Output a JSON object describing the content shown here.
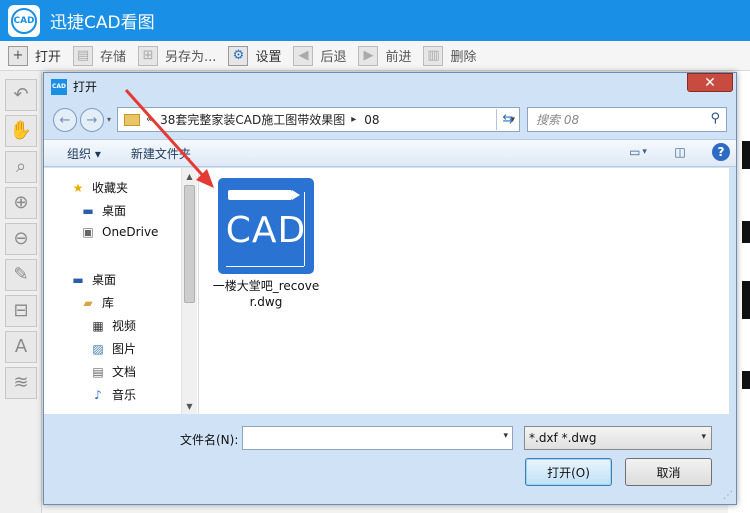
{
  "app": {
    "logo_text": "CAD",
    "title": "迅捷CAD看图"
  },
  "toolbar": [
    {
      "id": "open",
      "label": "打开",
      "icon": "plus-icon"
    },
    {
      "id": "save",
      "label": "存储",
      "icon": "disk-icon"
    },
    {
      "id": "save_as",
      "label": "另存为...",
      "icon": "save-as-icon"
    },
    {
      "id": "settings",
      "label": "设置",
      "icon": "gear-icon"
    },
    {
      "id": "back",
      "label": "后退",
      "icon": "back-arrow-icon"
    },
    {
      "id": "forward",
      "label": "前进",
      "icon": "forward-arrow-icon"
    },
    {
      "id": "delete",
      "label": "删除",
      "icon": "trash-icon"
    }
  ],
  "left_tools": [
    "undo-zoom-icon",
    "pan-hand-icon",
    "zoom-window-icon",
    "zoom-in-icon",
    "zoom-out-icon",
    "pencil-icon",
    "measure-icon",
    "text-icon",
    "layers-icon"
  ],
  "dialog": {
    "icon_text": "CAD",
    "title": "打开",
    "close_symbol": "✕",
    "address": {
      "sep_left": "«",
      "crumb1": "38套完整家装CAD施工图带效果图",
      "sep_mid": "▸",
      "crumb2": "08"
    },
    "search_placeholder": "搜索 08",
    "commands": {
      "organize": "组织 ▾",
      "new_folder": "新建文件夹"
    },
    "nav_pane": {
      "favorites": "收藏夹",
      "desktop_fav": "桌面",
      "onedrive": "OneDrive",
      "desktop": "桌面",
      "libraries": "库",
      "videos": "视频",
      "pictures": "图片",
      "documents": "文档",
      "music": "音乐"
    },
    "file": {
      "icon_text": "CAD",
      "name": "一楼大堂吧_recover.dwg"
    },
    "filename_label": "文件名(N):",
    "filename_value": "",
    "filetype": "*.dxf *.dwg",
    "open_button": "打开(O)",
    "cancel_button": "取消"
  },
  "colors": {
    "app_titlebar": "#1a8fe6",
    "cad_icon": "#2a73d2",
    "annotation_arrow": "#e53935",
    "close_button": "#c74b3f"
  }
}
